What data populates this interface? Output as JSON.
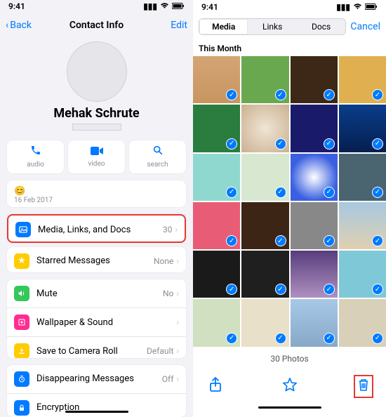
{
  "left": {
    "status_time": "9:41",
    "nav_back": "Back",
    "nav_title": "Contact Info",
    "nav_edit": "Edit",
    "contact_name": "Mehak Schrute",
    "actions": {
      "audio": "audio",
      "video": "video",
      "search": "search"
    },
    "status_date": "16 Feb 2017",
    "media_row": {
      "label": "Media, Links, and Docs",
      "value": "30"
    },
    "starred_row": {
      "label": "Starred Messages",
      "value": "None"
    },
    "mute_row": {
      "label": "Mute",
      "value": "No"
    },
    "wallpaper_row": {
      "label": "Wallpaper & Sound"
    },
    "camera_row": {
      "label": "Save to Camera Roll",
      "value": "Default"
    },
    "disappear_row": {
      "label": "Disappearing Messages",
      "value": "Off"
    },
    "encrypt_row": {
      "label": "Encryption"
    }
  },
  "right": {
    "status_time": "9:41",
    "tabs": {
      "media": "Media",
      "links": "Links",
      "docs": "Docs"
    },
    "cancel": "Cancel",
    "section": "This Month",
    "footer_count": "30 Photos"
  }
}
